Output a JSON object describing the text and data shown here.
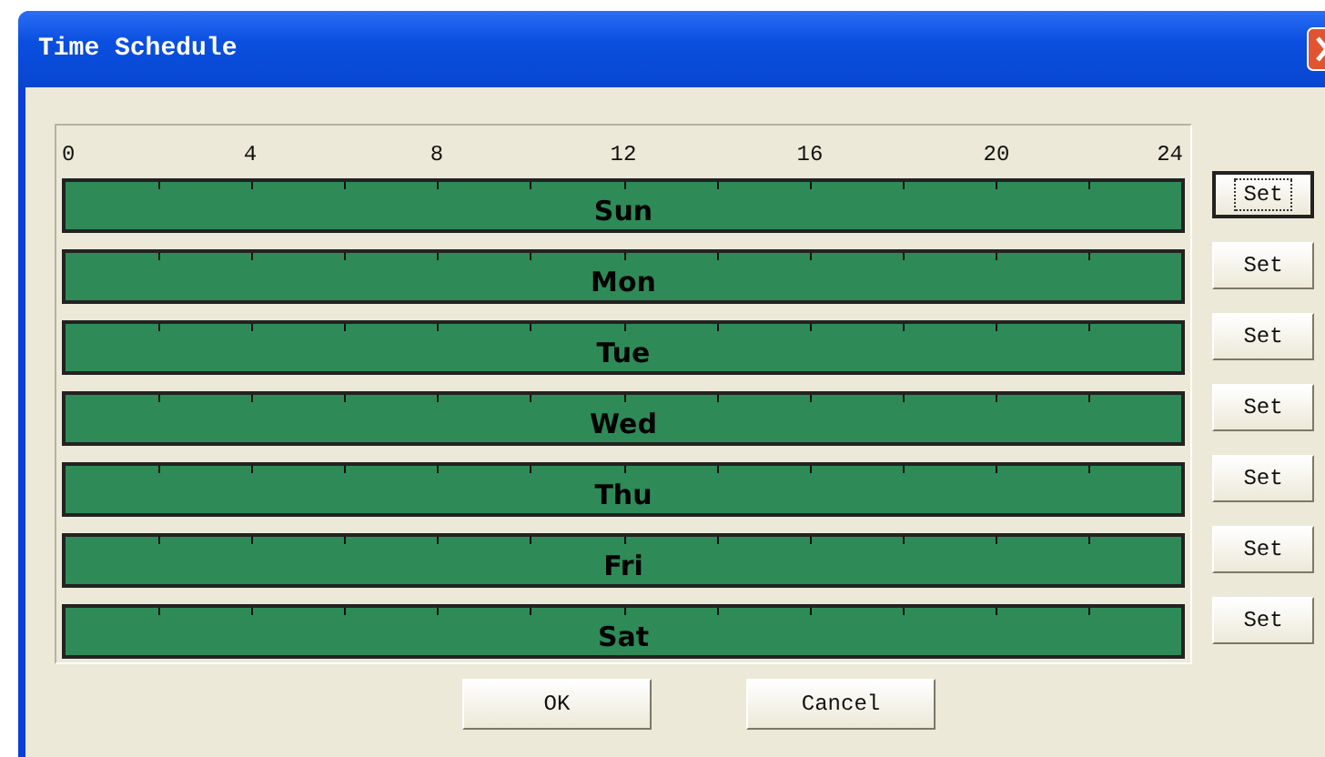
{
  "window": {
    "title": "Time Schedule"
  },
  "scale": [
    "0",
    "4",
    "8",
    "12",
    "16",
    "20",
    "24"
  ],
  "days": [
    {
      "name": "Sun",
      "button": "Set",
      "focused": true
    },
    {
      "name": "Mon",
      "button": "Set",
      "focused": false
    },
    {
      "name": "Tue",
      "button": "Set",
      "focused": false
    },
    {
      "name": "Wed",
      "button": "Set",
      "focused": false
    },
    {
      "name": "Thu",
      "button": "Set",
      "focused": false
    },
    {
      "name": "Fri",
      "button": "Set",
      "focused": false
    },
    {
      "name": "Sat",
      "button": "Set",
      "focused": false
    }
  ],
  "buttons": [
    "OK",
    "Cancel"
  ]
}
